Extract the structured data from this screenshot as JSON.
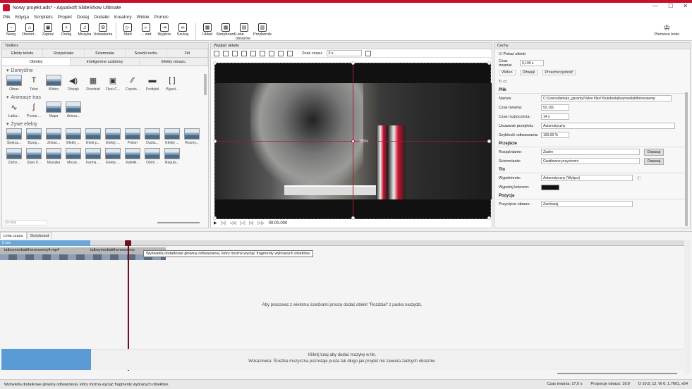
{
  "app": {
    "title": "Nowy projekt.ads* - AquaSoft SlideShow Ultimate",
    "min": "—",
    "max": "☐",
    "close": "✕"
  },
  "menu": [
    "Plik",
    "Edycja",
    "Scriptlets",
    "Projekt",
    "Dodaj",
    "Dodatki",
    "Kreatory",
    "Widok",
    "Pomoc"
  ],
  "toolbar": {
    "items": [
      {
        "label": "Nowy",
        "icon": "new-file-icon",
        "g": "▫"
      },
      {
        "label": "Otwórz...",
        "icon": "open-icon",
        "g": "⌂"
      },
      {
        "label": "Zapisz",
        "icon": "save-icon",
        "g": "▣"
      },
      {
        "label": "Dodaj",
        "icon": "add-icon",
        "g": "+"
      },
      {
        "label": "Muzyka",
        "icon": "music-icon",
        "g": "♫"
      },
      {
        "label": "Ustawienia",
        "icon": "settings-icon",
        "g": "⚙"
      },
      {
        "label": "Start",
        "icon": "play-icon",
        "g": "▷"
      },
      {
        "label": "... zad",
        "icon": "play-from-icon",
        "g": "▹"
      },
      {
        "label": "Wyjście",
        "icon": "export-icon",
        "g": "⇥"
      },
      {
        "label": "Szukaj",
        "icon": "search-icon",
        "g": "∞"
      },
      {
        "label": "Układ",
        "icon": "layout-icon",
        "g": "▦"
      },
      {
        "label": "Storyboard",
        "icon": "storyboard-icon",
        "g": "▦"
      },
      {
        "label": "Lista obrazów",
        "icon": "image-list-icon",
        "g": "▤"
      },
      {
        "label": "Przybornik",
        "icon": "toolbox-icon",
        "g": "▥"
      }
    ],
    "first_steps": "Pierwsze kroki"
  },
  "toolbox": {
    "header": "Toolbox",
    "tabs_row1": [
      "Efekty tekstu",
      "Rozjaśniale",
      "Ściemniale",
      "Ścieżki ruchu",
      "Filt"
    ],
    "tabs_row2": [
      "Obiekty",
      "Inteligentne szablony",
      "Efekty obrazu"
    ],
    "sections": [
      {
        "title": "Domyślne",
        "items": [
          {
            "label": "Obraz",
            "kind": "th"
          },
          {
            "label": "Tekst",
            "kind": "gl",
            "g": "T"
          },
          {
            "label": "Wideo",
            "kind": "th"
          },
          {
            "label": "Dźwięk",
            "kind": "gl",
            "g": "◀)"
          },
          {
            "label": "Rozdział",
            "kind": "gl",
            "g": "▦"
          },
          {
            "label": "Flexi-C...",
            "kind": "gl",
            "g": "▣"
          },
          {
            "label": "Często...",
            "kind": "gl",
            "g": "⁄⁄"
          },
          {
            "label": "Podtytuł",
            "kind": "gl",
            "g": "▬"
          },
          {
            "label": "Wypeł...",
            "kind": "gl",
            "g": "[ ]"
          }
        ]
      },
      {
        "title": "Animacje tras",
        "items": [
          {
            "label": "Łatka...",
            "kind": "gl",
            "g": "∿"
          },
          {
            "label": "Prosta ...",
            "kind": "gl",
            "g": "∫"
          },
          {
            "label": "Mapa",
            "kind": "th"
          },
          {
            "label": "Anima...",
            "kind": "th"
          }
        ]
      },
      {
        "title": "Żywe efekty",
        "items": [
          {
            "label": "Święca...",
            "kind": "th"
          },
          {
            "label": "Bump...",
            "kind": "th"
          },
          {
            "label": "Zmian...",
            "kind": "th"
          },
          {
            "label": "Efekty ...",
            "kind": "th"
          },
          {
            "label": "Efekt p...",
            "kind": "th"
          },
          {
            "label": "Efekty ...",
            "kind": "th"
          },
          {
            "label": "Pokon",
            "kind": "th"
          },
          {
            "label": "Duota...",
            "kind": "th"
          },
          {
            "label": "Efekty ...",
            "kind": "th"
          },
          {
            "label": "Rozmy...",
            "kind": "th"
          },
          {
            "label": "Zamo...",
            "kind": "th"
          },
          {
            "label": "Stary fi...",
            "kind": "th"
          },
          {
            "label": "Mozaika",
            "kind": "th"
          },
          {
            "label": "Mozai...",
            "kind": "th"
          },
          {
            "label": "Farma ...",
            "kind": "th"
          },
          {
            "label": "Efekty ...",
            "kind": "th"
          },
          {
            "label": "Kafelki...",
            "kind": "th"
          },
          {
            "label": "Obrót ...",
            "kind": "th"
          },
          {
            "label": "Regula...",
            "kind": "th"
          }
        ]
      }
    ],
    "search_placeholder": "Szukaj"
  },
  "preview": {
    "header": "Wygląd układu",
    "znak_czasu_label": "Znak czasu:",
    "znak_czasu_value": "0 s",
    "timecode": "00:00.000",
    "overlay_value": "100%"
  },
  "props": {
    "header": "Cechy",
    "show_object": "Pokaż obiekt",
    "duration_label": "Czas trwania:",
    "duration_value": "9,196 s",
    "tabs": [
      "Wideo",
      "Dźwięk",
      "Przezroczystość"
    ],
    "plik_head": "Plik",
    "rows": [
      {
        "label": "Nazwa:",
        "value": "C:\\Users\\damian_garanty\\Video files\\Youtube\\talboymediatitheneosemp"
      },
      {
        "label": "Czas trwania:",
        "value": "52,191"
      },
      {
        "label": "Czas rozpoczęcia:",
        "value": "14 s"
      },
      {
        "label": "Usuwanie przeplotu:",
        "value": "Automatyczny"
      },
      {
        "label": "Szybkość odtwarzania:",
        "value": "100,00 %"
      }
    ],
    "przejscie_head": "Przejście",
    "trans": [
      {
        "label": "Rozjaśnianie:",
        "value": "Żaden",
        "btn": "Dopasuj"
      },
      {
        "label": "Ściemnianie:",
        "value": "Gwałtowne przyciemni",
        "btn": "Dopasuj"
      }
    ],
    "tlo_head": "Tło",
    "fill": [
      {
        "label": "Wypełnienie:",
        "value": "Automatyczny (Wyłącz)"
      },
      {
        "label": "Wypełnij kolorem:",
        "value": ""
      }
    ],
    "pozycja_head": "Pozycja",
    "cut": {
      "label": "Przycięcie obrazu:",
      "value": "Zachowaj"
    }
  },
  "timeline": {
    "tabs": [
      "Linia czasu",
      "Storyboard"
    ],
    "ruler_start": "0 min",
    "clip1": "talboymediatitheneosemp4.mp4",
    "clip2": "talboymediatitheneosemp",
    "tooltip": "Wyświetla dodatkowe głowicę odtwarzania, który można wyciąć fragmenty wybranych obiektów.",
    "empty_msg": "Aby pracować z wieloma ścieżkami proszę dodać obiekt \"Rozdział\" z paska narzędzi.",
    "music_msg1": "Kliknij tutaj aby dodać muzykę w tle.",
    "music_msg2": "Wskazówka: Ścieżka muzyczna pozostaje pusta tak długo jak projekt nie zawiera żadnych obrazów."
  },
  "status": {
    "text": "Wyświetla dodatkowe głowicę odtwarzania, który można wyciąć fragmenty wybranych obiektów.",
    "right": [
      "Czas trwania: 17,0 s",
      "Proporcje obrazu: 16:9",
      "D 10.8, 12, W 6, 1.7601, x64"
    ]
  },
  "colors": {
    "brand": "#c8102e",
    "selection": "#6aa7d6"
  }
}
